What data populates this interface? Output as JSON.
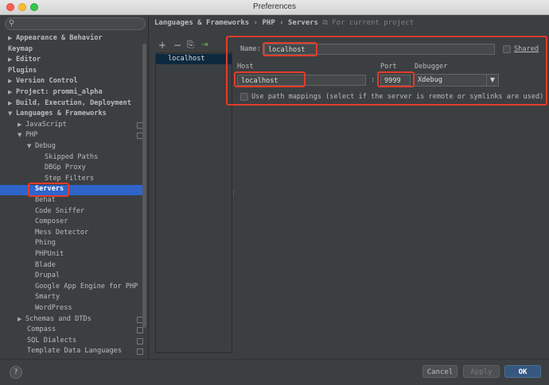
{
  "window": {
    "title": "Preferences"
  },
  "colors": {
    "selection": "#2f65ca",
    "highlight": "#e33b2b",
    "ok_button": "#365880"
  },
  "sidebar": {
    "search_icon": "magnifier-icon",
    "items": [
      {
        "label": "Appearance & Behavior",
        "bold": true,
        "arrow": "▶"
      },
      {
        "label": "Keymap",
        "bold": true,
        "arrow": ""
      },
      {
        "label": "Editor",
        "bold": true,
        "arrow": "▶"
      },
      {
        "label": "Plugins",
        "bold": true,
        "arrow": ""
      },
      {
        "label": "Version Control",
        "bold": true,
        "arrow": "▶"
      },
      {
        "label": "Project: prommi_alpha",
        "bold": true,
        "arrow": "▶"
      },
      {
        "label": "Build, Execution, Deployment",
        "bold": true,
        "arrow": "▶"
      },
      {
        "label": "Languages & Frameworks",
        "bold": true,
        "arrow": "▼"
      },
      {
        "label": "JavaScript",
        "bold": false,
        "arrow": "▶"
      },
      {
        "label": "PHP",
        "bold": false,
        "arrow": "▼"
      },
      {
        "label": "Debug",
        "bold": false,
        "arrow": "▼"
      },
      {
        "label": "Skipped Paths",
        "bold": false,
        "arrow": ""
      },
      {
        "label": "DBGp Proxy",
        "bold": false,
        "arrow": ""
      },
      {
        "label": "Step Filters",
        "bold": false,
        "arrow": ""
      },
      {
        "label": "Servers",
        "bold": true,
        "arrow": ""
      },
      {
        "label": "Behat",
        "bold": false,
        "arrow": ""
      },
      {
        "label": "Code Sniffer",
        "bold": false,
        "arrow": ""
      },
      {
        "label": "Composer",
        "bold": false,
        "arrow": ""
      },
      {
        "label": "Mess Detector",
        "bold": false,
        "arrow": ""
      },
      {
        "label": "Phing",
        "bold": false,
        "arrow": ""
      },
      {
        "label": "PHPUnit",
        "bold": false,
        "arrow": ""
      },
      {
        "label": "Blade",
        "bold": false,
        "arrow": ""
      },
      {
        "label": "Drupal",
        "bold": false,
        "arrow": ""
      },
      {
        "label": "Google App Engine for PHP",
        "bold": false,
        "arrow": ""
      },
      {
        "label": "Smarty",
        "bold": false,
        "arrow": ""
      },
      {
        "label": "WordPress",
        "bold": false,
        "arrow": ""
      },
      {
        "label": "Schemas and DTDs",
        "bold": false,
        "arrow": "▶"
      },
      {
        "label": "Compass",
        "bold": false,
        "arrow": ""
      },
      {
        "label": "SQL Dialects",
        "bold": false,
        "arrow": ""
      },
      {
        "label": "Template Data Languages",
        "bold": false,
        "arrow": ""
      }
    ]
  },
  "breadcrumb": {
    "part1": "Languages & Frameworks",
    "sep1": "›",
    "part2": "PHP",
    "sep2": "›",
    "part3": "Servers",
    "hint_icon": "⧉",
    "hint": "For current project"
  },
  "toolbar": {
    "add": "+",
    "remove": "−",
    "copy": "⎘",
    "import": "⇥"
  },
  "servers": {
    "items": [
      "localhost"
    ]
  },
  "form": {
    "name_label": "Name:",
    "name_value": "localhost",
    "shared_label": "Shared",
    "host_label": "Host",
    "host_value": "localhost",
    "colon": ":",
    "port_label": "Port",
    "port_value": "9999",
    "debugger_label": "Debugger",
    "debugger_value": "Xdebug",
    "path_mappings_label": "Use path mappings (select if the server is remote or symlinks are used)"
  },
  "footer": {
    "help": "?",
    "cancel": "Cancel",
    "apply": "Apply",
    "ok": "OK"
  }
}
